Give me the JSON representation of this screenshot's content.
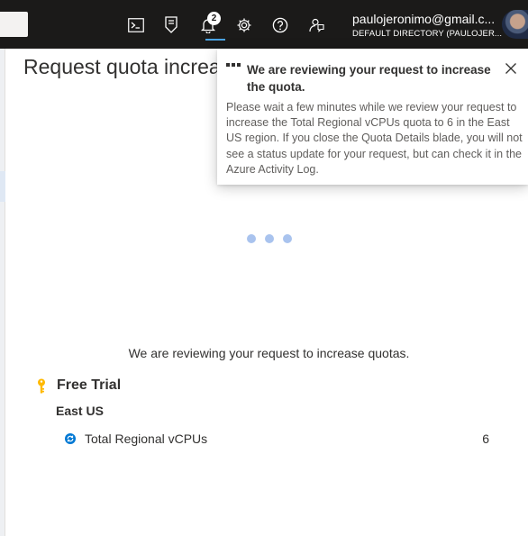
{
  "topbar": {
    "notification_count": "2",
    "account_email": "paulojeronimo@gmail.c...",
    "account_directory": "DEFAULT DIRECTORY (PAULOJER...",
    "icons": [
      "cloud-shell-icon",
      "directory-filter-icon",
      "notifications-icon",
      "settings-icon",
      "help-icon",
      "feedback-icon"
    ]
  },
  "blade": {
    "title": "Request quota increase",
    "status_message": "We are reviewing your request to increase quotas.",
    "subscription": "Free Trial",
    "region": "East US",
    "quotas": [
      {
        "name": "Total Regional vCPUs",
        "value": "6"
      }
    ]
  },
  "toast": {
    "title": "We are reviewing your request to increase the quota.",
    "body": "Please wait a few minutes while we review your request to increase the Total Regional vCPUs quota to 6 in the East US region. If you close the Quota Details blade, you will not see a status update for your request, but can check it in the Azure Activity Log."
  },
  "colors": {
    "topbar_bg": "#1b1a19",
    "accent": "#4ba3e3",
    "loader_dots": "#a9c3ee",
    "key_icon": "#ffb900",
    "sync_icon": "#0078d4"
  }
}
